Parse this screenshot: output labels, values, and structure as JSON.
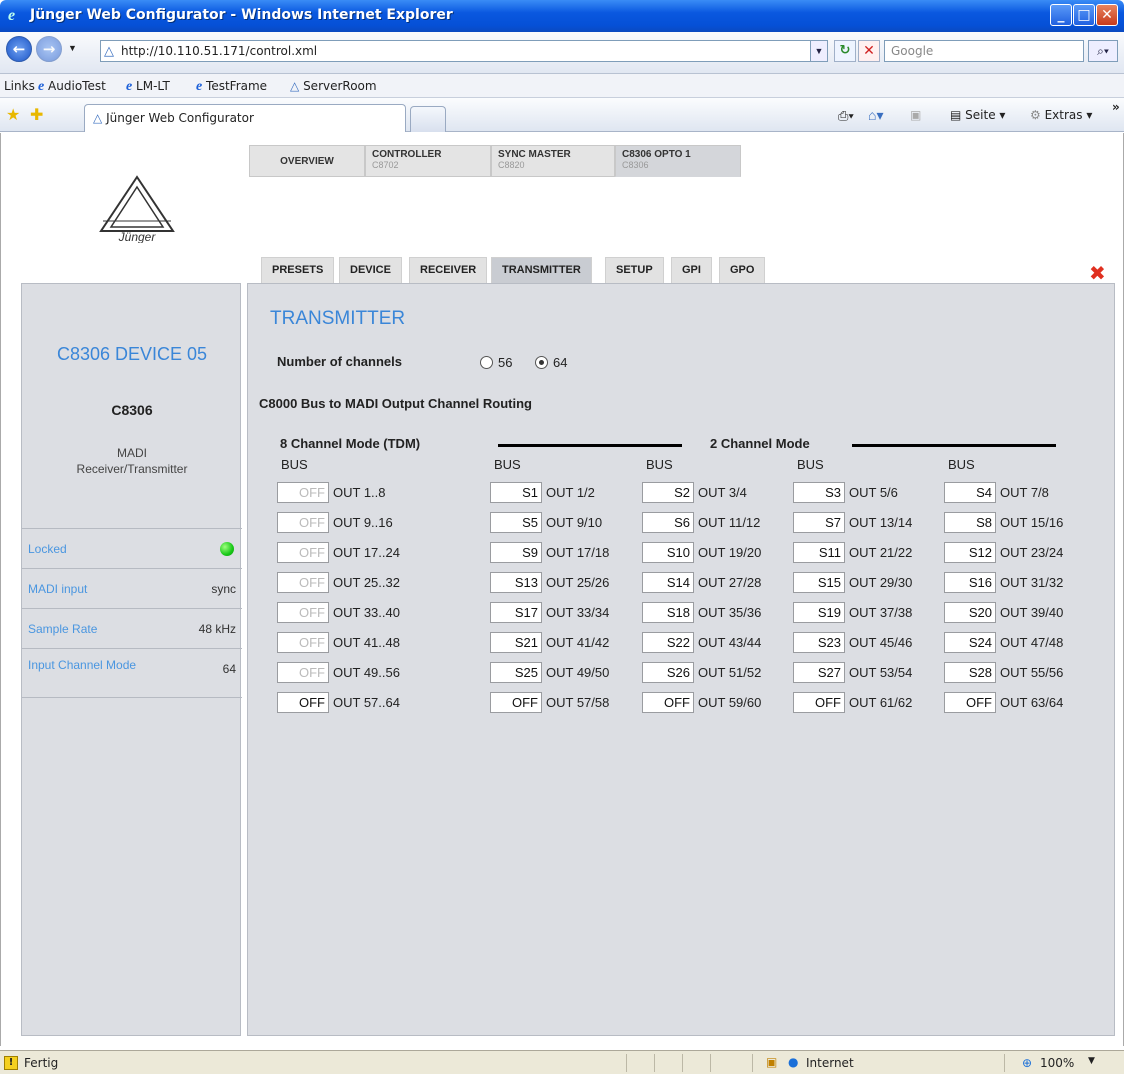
{
  "window": {
    "title": "Jünger Web Configurator - Windows Internet Explorer"
  },
  "browser": {
    "url": "http://10.110.51.171/control.xml",
    "search_placeholder": "Google",
    "links_label": "Links",
    "links": [
      "AudioTest",
      "LM-LT",
      "TestFrame",
      "ServerRoom"
    ],
    "tab_title": "Jünger Web Configurator",
    "commands": {
      "page": "Seite",
      "extras": "Extras"
    }
  },
  "logo_text": "Jünger",
  "device_tabs": [
    {
      "name": "OVERVIEW",
      "sub": ""
    },
    {
      "name": "CONTROLLER",
      "sub": "C8702"
    },
    {
      "name": "SYNC MASTER",
      "sub": "C8820"
    },
    {
      "name": "C8306 OPTO 1",
      "sub": "C8306"
    }
  ],
  "sub_tabs": [
    "PRESETS",
    "DEVICE",
    "RECEIVER",
    "TRANSMITTER",
    "SETUP",
    "GPI",
    "GPO"
  ],
  "active_sub_tab": "TRANSMITTER",
  "device": {
    "name": "C8306 DEVICE 05",
    "model": "C8306",
    "desc_line1": "MADI",
    "desc_line2": "Receiver/Transmitter"
  },
  "status": [
    {
      "label": "Locked",
      "value": "",
      "led": "green"
    },
    {
      "label": "MADI input",
      "value": "sync"
    },
    {
      "label": "Sample Rate",
      "value": "48 kHz"
    },
    {
      "label": "Input Channel Mode",
      "value": "64"
    }
  ],
  "transmitter": {
    "title": "TRANSMITTER",
    "channels_label": "Number of channels",
    "channel_options": [
      "56",
      "64"
    ],
    "channels_selected": "64",
    "routing_title": "C8000 Bus to MADI Output Channel Routing",
    "mode8_label": "8 Channel Mode (TDM)",
    "mode2_label": "2 Channel Mode",
    "bus_label": "BUS",
    "rows": [
      [
        [
          "OFF",
          "OUT 1..8"
        ],
        [
          "S1",
          "OUT 1/2"
        ],
        [
          "S2",
          "OUT 3/4"
        ],
        [
          "S3",
          "OUT 5/6"
        ],
        [
          "S4",
          "OUT 7/8"
        ]
      ],
      [
        [
          "OFF",
          "OUT 9..16"
        ],
        [
          "S5",
          "OUT 9/10"
        ],
        [
          "S6",
          "OUT 11/12"
        ],
        [
          "S7",
          "OUT 13/14"
        ],
        [
          "S8",
          "OUT 15/16"
        ]
      ],
      [
        [
          "OFF",
          "OUT 17..24"
        ],
        [
          "S9",
          "OUT 17/18"
        ],
        [
          "S10",
          "OUT 19/20"
        ],
        [
          "S11",
          "OUT 21/22"
        ],
        [
          "S12",
          "OUT 23/24"
        ]
      ],
      [
        [
          "OFF",
          "OUT 25..32"
        ],
        [
          "S13",
          "OUT 25/26"
        ],
        [
          "S14",
          "OUT 27/28"
        ],
        [
          "S15",
          "OUT 29/30"
        ],
        [
          "S16",
          "OUT 31/32"
        ]
      ],
      [
        [
          "OFF",
          "OUT 33..40"
        ],
        [
          "S17",
          "OUT 33/34"
        ],
        [
          "S18",
          "OUT 35/36"
        ],
        [
          "S19",
          "OUT 37/38"
        ],
        [
          "S20",
          "OUT 39/40"
        ]
      ],
      [
        [
          "OFF",
          "OUT 41..48"
        ],
        [
          "S21",
          "OUT 41/42"
        ],
        [
          "S22",
          "OUT 43/44"
        ],
        [
          "S23",
          "OUT 45/46"
        ],
        [
          "S24",
          "OUT 47/48"
        ]
      ],
      [
        [
          "OFF",
          "OUT 49..56"
        ],
        [
          "S25",
          "OUT 49/50"
        ],
        [
          "S26",
          "OUT 51/52"
        ],
        [
          "S27",
          "OUT 53/54"
        ],
        [
          "S28",
          "OUT 55/56"
        ]
      ],
      [
        [
          "OFF",
          "OUT 57..64"
        ],
        [
          "OFF",
          "OUT 57/58"
        ],
        [
          "OFF",
          "OUT 59/60"
        ],
        [
          "OFF",
          "OUT 61/62"
        ],
        [
          "OFF",
          "OUT 63/64"
        ]
      ]
    ]
  },
  "statusbar": {
    "text": "Fertig",
    "zone": "Internet",
    "zoom": "100%"
  }
}
